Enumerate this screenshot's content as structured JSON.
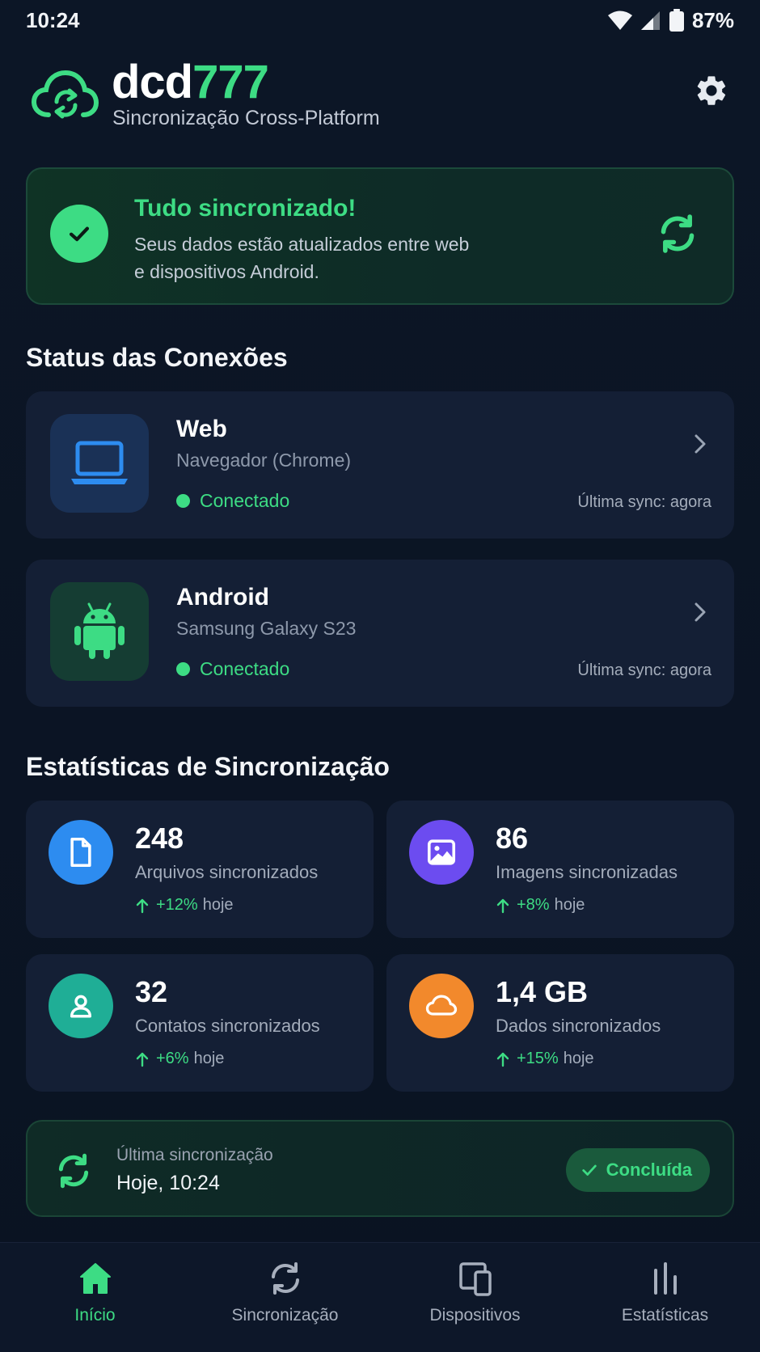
{
  "status_bar": {
    "time": "10:24",
    "battery": "87%"
  },
  "header": {
    "brand_part1": "dcd",
    "brand_part2": "777",
    "subtitle": "Sincronização Cross-Platform"
  },
  "banner": {
    "title": "Tudo sincronizado!",
    "description": "Seus dados estão atualizados entre web e dispositivos Android."
  },
  "connections": {
    "title": "Status das Conexões",
    "items": [
      {
        "name": "Web",
        "device": "Navegador (Chrome)",
        "status": "Conectado",
        "last_sync": "Última sync: agora"
      },
      {
        "name": "Android",
        "device": "Samsung Galaxy S23",
        "status": "Conectado",
        "last_sync": "Última sync: agora"
      }
    ]
  },
  "stats": {
    "title": "Estatísticas de Sincronização",
    "items": [
      {
        "value": "248",
        "label": "Arquivos sincronizados",
        "trend": "+12%",
        "period": "hoje",
        "color": "#2d8cf0"
      },
      {
        "value": "86",
        "label": "Imagens sincronizadas",
        "trend": "+8%",
        "period": "hoje",
        "color": "#6c4cf0"
      },
      {
        "value": "32",
        "label": "Contatos sincronizados",
        "trend": "+6%",
        "period": "hoje",
        "color": "#1fae96"
      },
      {
        "value": "1,4 GB",
        "label": "Dados sincronizados",
        "trend": "+15%",
        "period": "hoje",
        "color": "#f2892c"
      }
    ]
  },
  "last_sync": {
    "caption": "Última sincronização",
    "value": "Hoje, 10:24",
    "badge": "Concluída"
  },
  "nav": {
    "items": [
      {
        "label": "Início",
        "icon": "home-icon",
        "active": true
      },
      {
        "label": "Sincronização",
        "icon": "sync-icon",
        "active": false
      },
      {
        "label": "Dispositivos",
        "icon": "devices-icon",
        "active": false
      },
      {
        "label": "Estatísticas",
        "icon": "bar-chart-icon",
        "active": false
      }
    ]
  },
  "colors": {
    "accent": "#3ddc84",
    "background": "#0b1423",
    "card": "#141f35"
  }
}
